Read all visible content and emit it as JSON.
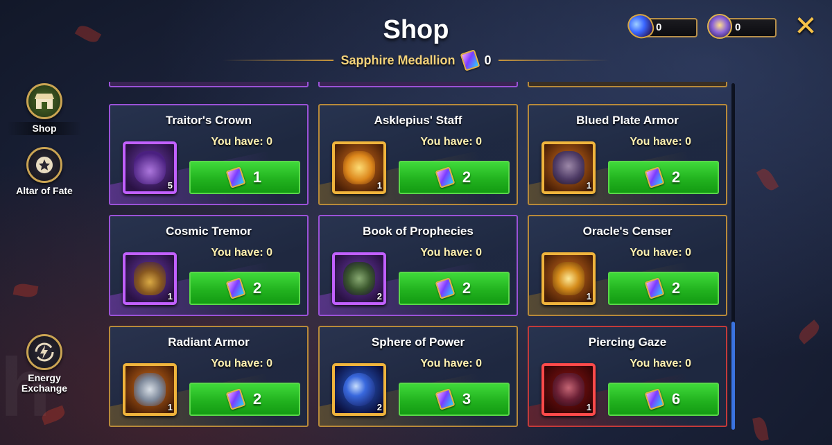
{
  "header": {
    "title": "Shop",
    "currency_label": "Sapphire Medallion",
    "currency_count": "0"
  },
  "top_currencies": [
    {
      "icon": "blue-gem-icon",
      "value": "0"
    },
    {
      "icon": "emblem-icon",
      "value": "0"
    }
  ],
  "close_glyph": "✕",
  "sidebar": {
    "items": [
      {
        "label": "Shop",
        "icon": "shop-icon",
        "active": true
      },
      {
        "label": "Altar of Fate",
        "icon": "star-icon",
        "active": false
      },
      {
        "label": "Energy Exchange",
        "icon": "energy-exchange-icon",
        "active": false
      }
    ]
  },
  "items": [
    {
      "name": "Traitor's Crown",
      "have": "You have: 0",
      "qty": "5",
      "price": "1",
      "rarity": "purple"
    },
    {
      "name": "Asklepius' Staff",
      "have": "You have: 0",
      "qty": "1",
      "price": "2",
      "rarity": "gold"
    },
    {
      "name": "Blued Plate Armor",
      "have": "You have: 0",
      "qty": "1",
      "price": "2",
      "rarity": "gold"
    },
    {
      "name": "Cosmic Tremor",
      "have": "You have: 0",
      "qty": "1",
      "price": "2",
      "rarity": "purple"
    },
    {
      "name": "Book of Prophecies",
      "have": "You have: 0",
      "qty": "2",
      "price": "2",
      "rarity": "purple"
    },
    {
      "name": "Oracle's Censer",
      "have": "You have: 0",
      "qty": "1",
      "price": "2",
      "rarity": "gold"
    },
    {
      "name": "Radiant Armor",
      "have": "You have: 0",
      "qty": "1",
      "price": "2",
      "rarity": "gold"
    },
    {
      "name": "Sphere of Power",
      "have": "You have: 0",
      "qty": "2",
      "price": "3",
      "rarity": "gold"
    },
    {
      "name": "Piercing Gaze",
      "have": "You have: 0",
      "qty": "1",
      "price": "6",
      "rarity": "red"
    }
  ],
  "colors": {
    "buy_button": "#22b31f",
    "purple_rarity": "#9b52d8",
    "gold_rarity": "#b88a3a",
    "red_rarity": "#c33a3a",
    "title_gold": "#f3d27a",
    "close_button": "#f7c248"
  }
}
